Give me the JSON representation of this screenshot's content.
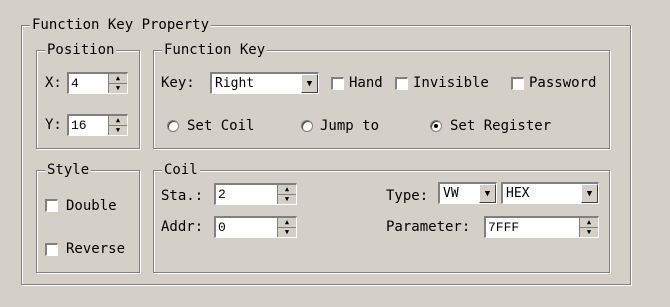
{
  "outer_group": {
    "title": "Function Key Property"
  },
  "position": {
    "title": "Position",
    "x_label": "X:",
    "x_value": "4",
    "y_label": "Y:",
    "y_value": "16"
  },
  "function_key": {
    "title": "Function Key",
    "key_label": "Key:",
    "key_value": "Right",
    "checkboxes": [
      {
        "label": "Hand",
        "checked": false
      },
      {
        "label": "Invisible",
        "checked": false
      },
      {
        "label": "Password",
        "checked": false
      }
    ],
    "radios": [
      {
        "label": "Set Coil",
        "selected": false
      },
      {
        "label": "Jump to",
        "selected": false
      },
      {
        "label": "Set Register",
        "selected": true
      }
    ]
  },
  "style": {
    "title": "Style",
    "double_label": "Double",
    "reverse_label": "Reverse"
  },
  "coil": {
    "title": "Coil",
    "sta_label": "Sta.:",
    "sta_value": "2",
    "addr_label": "Addr:",
    "addr_value": "0",
    "type_label": "Type:",
    "type_value": "VW",
    "format_value": "HEX",
    "parameter_label": "Parameter:",
    "parameter_value": "7FFF"
  },
  "icons": {
    "spin_up": "▲",
    "spin_down": "▼",
    "dropdown": "▼"
  }
}
